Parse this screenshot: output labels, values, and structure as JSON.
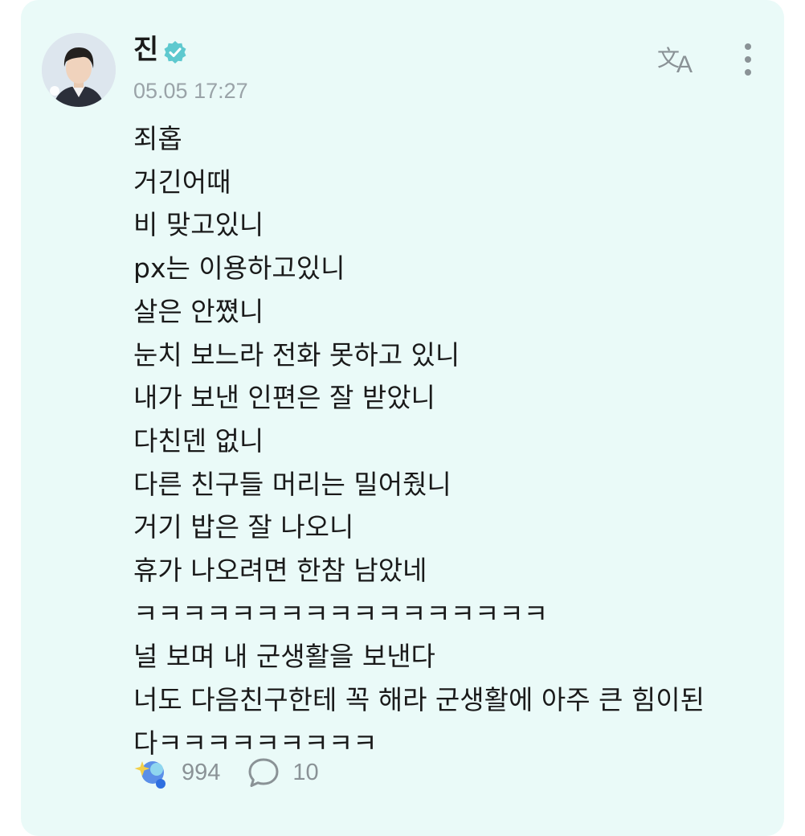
{
  "post": {
    "author": {
      "name": "진",
      "verified_icon": "verified-badge-icon",
      "avatar_icon": "profile-photo"
    },
    "timestamp": "05.05 17:27",
    "actions": {
      "translate_icon": "translate-icon",
      "more_icon": "more-vertical-icon"
    },
    "body_lines": [
      "죄홉",
      "거긴어때",
      "비 맞고있니",
      "px는 이용하고있니",
      "살은 안쪘니",
      "눈치 보느라 전화 못하고 있니",
      "내가 보낸 인편은 잘 받았니",
      "다친덴 없니",
      "다른 친구들 머리는 밀어줬니",
      "거기 밥은 잘 나오니",
      "휴가 나오려면 한참 남았네",
      "ㅋㅋㅋㅋㅋㅋㅋㅋㅋㅋㅋㅋㅋㅋㅋㅋㅋ",
      "널 보며 내 군생활을 보낸다",
      "너도 다음친구한테 꼭 해라 군생활에 아주 큰 힘이된",
      "다ㅋㅋㅋㅋㅋㅋㅋㅋㅋ"
    ],
    "stats": {
      "like_icon": "sparkle-reaction-icon",
      "like_count": "994",
      "comment_icon": "comment-bubble-icon",
      "comment_count": "10"
    }
  },
  "colors": {
    "card_background": "#eafaf8",
    "text": "#1a1a1a",
    "muted_text": "#9aa3a8",
    "verified_badge": "#5ec9cf"
  }
}
